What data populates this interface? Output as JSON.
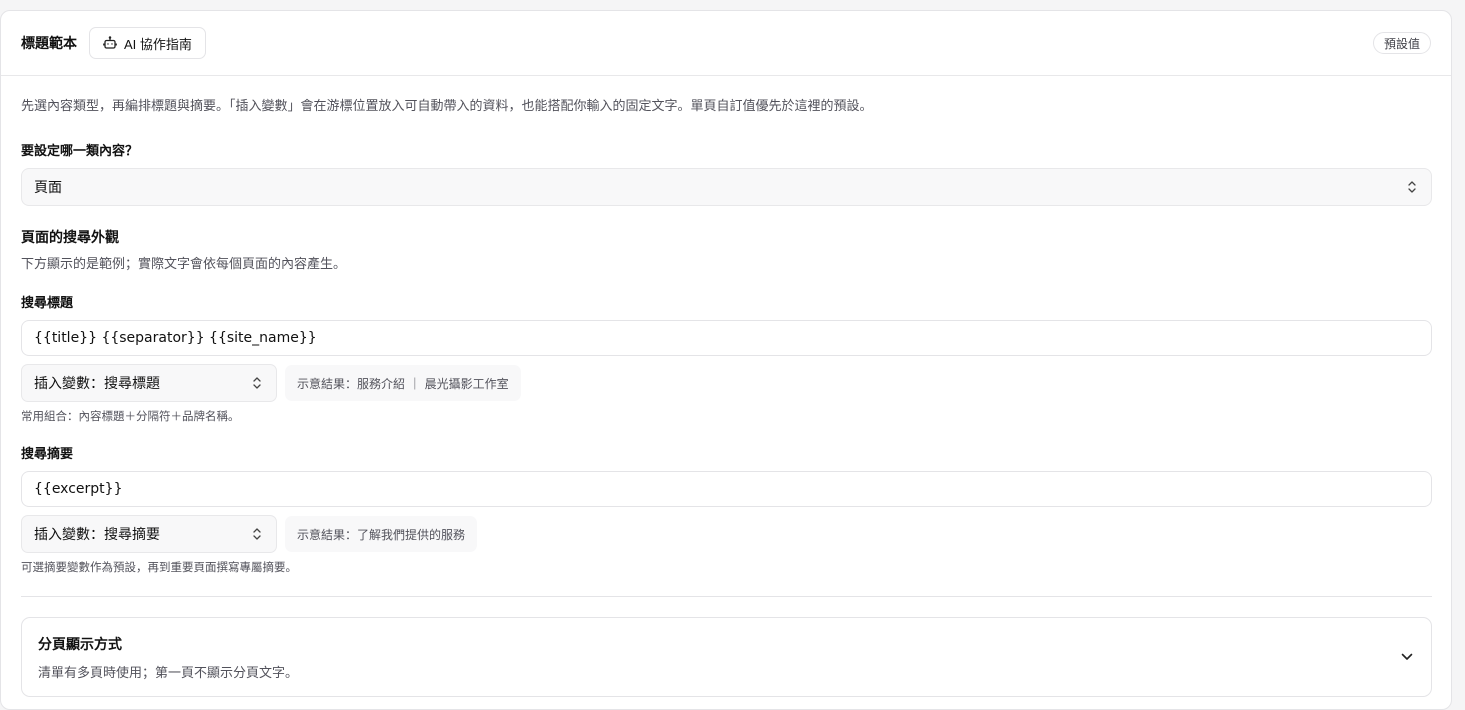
{
  "header": {
    "title": "標題範本",
    "ai_guide_label": "AI 協作指南",
    "default_badge": "預設值"
  },
  "intro": "先選內容類型，再編排標題與摘要。「插入變數」會在游標位置放入可自動帶入的資料，也能搭配你輸入的固定文字。單頁自訂值優先於這裡的預設。",
  "content_type": {
    "label": "要設定哪一類內容？",
    "selected": "頁面"
  },
  "appearance": {
    "title": "頁面的搜尋外觀",
    "subtitle": "下方顯示的是範例；實際文字會依每個頁面的內容產生。"
  },
  "search_title": {
    "label": "搜尋標題",
    "value": "{{title}} {{separator}} {{site_name}}",
    "insert_var_label": "插入變數：搜尋標題",
    "preview": "示意結果：服務介紹 ｜ 晨光攝影工作室",
    "hint": "常用組合：內容標題＋分隔符＋品牌名稱。"
  },
  "search_excerpt": {
    "label": "搜尋摘要",
    "value": "{{excerpt}}",
    "insert_var_label": "插入變數：搜尋摘要",
    "preview": "示意結果：了解我們提供的服務",
    "hint": "可選摘要變數作為預設，再到重要頁面撰寫專屬摘要。"
  },
  "pagination": {
    "title": "分頁顯示方式",
    "subtitle": "清單有多頁時使用；第一頁不顯示分頁文字。"
  }
}
